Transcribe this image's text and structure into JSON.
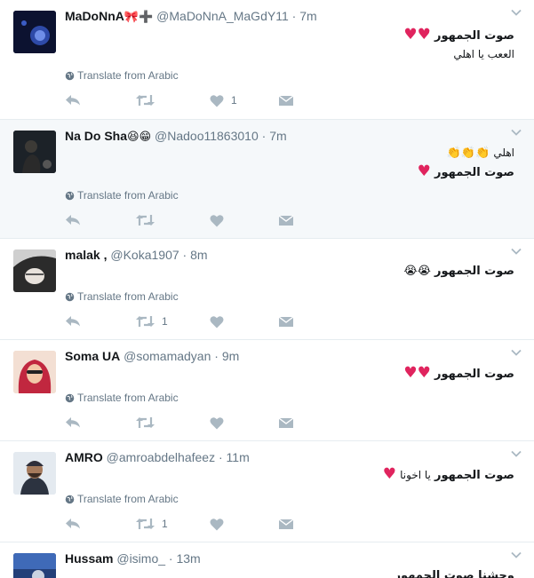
{
  "translate_label": "Translate from Arabic",
  "colors": {
    "heart": "#e0245e",
    "icon": "#aab8c2",
    "muted": "#657786",
    "highlight": "#f5f8fa"
  },
  "tweets": [
    {
      "name": "MaDoNnA",
      "name_emoji": "🎀➕",
      "handle": "@MaDoNnA_MaGdY11",
      "time": "7m",
      "line1": "صوت الجمهور",
      "line1_emoji": "♥♥",
      "line2": "الععب يا اهلي",
      "line2_emoji": "",
      "like_count": "1",
      "retweet_count": ""
    },
    {
      "name": "Na Do Sha",
      "name_emoji": "😆😁",
      "handle": "@Nadoo11863010",
      "time": "7m",
      "line1": "اهلي",
      "line1_emoji": "👏👏👏",
      "line2": "صوت الجمهور",
      "line2_emoji": "♥",
      "like_count": "",
      "retweet_count": ""
    },
    {
      "name": "malak ,",
      "name_emoji": "",
      "handle": "@Koka1907",
      "time": "8m",
      "line1": "صوت الجمهور",
      "line1_emoji": "😭😭",
      "like_count": "",
      "retweet_count": "1"
    },
    {
      "name": "Soma UA",
      "name_emoji": "",
      "handle": "@somamadyan",
      "time": "9m",
      "line1": "صوت الجمهور",
      "line1_emoji": "♥♥",
      "like_count": "",
      "retweet_count": ""
    },
    {
      "name": "AMRO",
      "name_emoji": "",
      "handle": "@amroabdelhafeez",
      "time": "11m",
      "line1": "صوت الجمهور",
      "line1_suffix": "يا اخونا",
      "line1_emoji": "♥",
      "like_count": "",
      "retweet_count": "1"
    },
    {
      "name": "Hussam",
      "name_emoji": "",
      "handle": "@isimo_",
      "time": "13m",
      "line1": "وحشنا صوت الجمهور"
    }
  ]
}
